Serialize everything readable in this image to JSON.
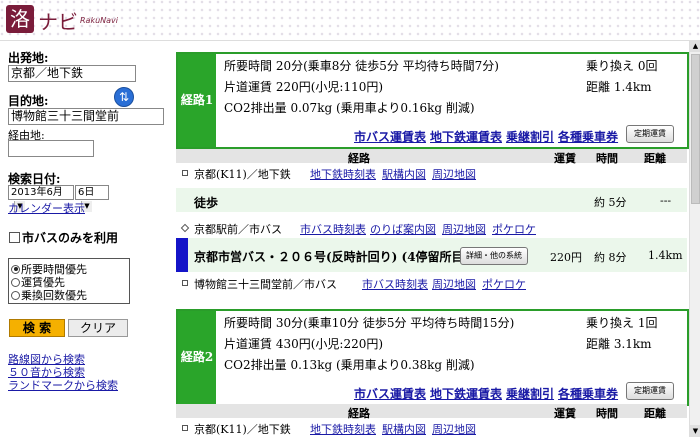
{
  "header": {
    "logo_glyph": "洛",
    "logo_text": "ナビ",
    "logo_sub": "RakuNavi"
  },
  "sidebar": {
    "from_label": "出発地:",
    "from_value": "京都／地下鉄",
    "to_label": "目的地:",
    "to_value": "博物館三十三間堂前",
    "via_label": "経由地:",
    "via_value": "",
    "date_label": "検索日付:",
    "date_month": "2013年6月",
    "date_day": "6日",
    "calendar_link": "カレンダー表示",
    "bus_only_label": "市バスのみを利用",
    "sort_options": [
      "所要時間優先",
      "運賃優先",
      "乗換回数優先"
    ],
    "sort_selected": 0,
    "search_button": "検 索",
    "clear_button": "クリア",
    "links": [
      "路線図から検索",
      "５０音から検索",
      "ランドマークから検索"
    ]
  },
  "routes": [
    {
      "tag": "経路1",
      "time_line": "所要時間 20分(乗車8分 徒歩5分 平均待ち時間7分)",
      "fare_line": "片道運賃 220円(小児:110円)",
      "co2_line": "CO2排出量 0.07kg (乗用車より0.16kg 削減)",
      "transfer": "乗り換え 0回",
      "distance": "距離 1.4km",
      "links": [
        "市バス運賃表",
        "地下鉄運賃表",
        "乗継割引",
        "各種乗車券"
      ],
      "pass_button": "定期運賃",
      "detail": {
        "headers": [
          "経路",
          "運賃",
          "時間",
          "距離"
        ],
        "origin": {
          "name": "京都(K11)／地下鉄",
          "links": [
            "地下鉄時刻表",
            "駅構内図",
            "周辺地図"
          ]
        },
        "walk": {
          "label": "徒歩",
          "time": "約 5分",
          "dist": "---"
        },
        "transfer_stop": {
          "name": "京都駅前／市バス",
          "links": [
            "市バス時刻表",
            "のりば案内図",
            "周辺地図",
            "ポケロケ"
          ]
        },
        "ride": {
          "name": "京都市営バス・２０６号(反時計回り) (4停留所目)",
          "button": "詳細・他の系統",
          "fare": "220円",
          "time": "約 8分",
          "dist": "1.4km"
        },
        "dest": {
          "name": "博物館三十三間堂前／市バス",
          "links": [
            "市バス時刻表",
            "周辺地図",
            "ポケロケ"
          ]
        }
      }
    },
    {
      "tag": "経路2",
      "time_line": "所要時間 30分(乗車10分 徒歩5分 平均待ち時間15分)",
      "fare_line": "片道運賃 430円(小児:220円)",
      "co2_line": "CO2排出量 0.13kg (乗用車より0.38kg 削減)",
      "transfer": "乗り換え 1回",
      "distance": "距離 3.1km",
      "links": [
        "市バス運賃表",
        "地下鉄運賃表",
        "乗継割引",
        "各種乗車券"
      ],
      "pass_button": "定期運賃",
      "detail": {
        "headers": [
          "経路",
          "運賃",
          "時間",
          "距離"
        ],
        "origin": {
          "name": "京都(K11)／地下鉄",
          "links": [
            "地下鉄時刻表",
            "駅構内図",
            "周辺地図"
          ]
        }
      }
    }
  ],
  "colors": {
    "accent_green": "#2aa52a",
    "brand": "#7a1c3a",
    "link": "#1a1aa6",
    "bus_bar": "#1414c8"
  }
}
